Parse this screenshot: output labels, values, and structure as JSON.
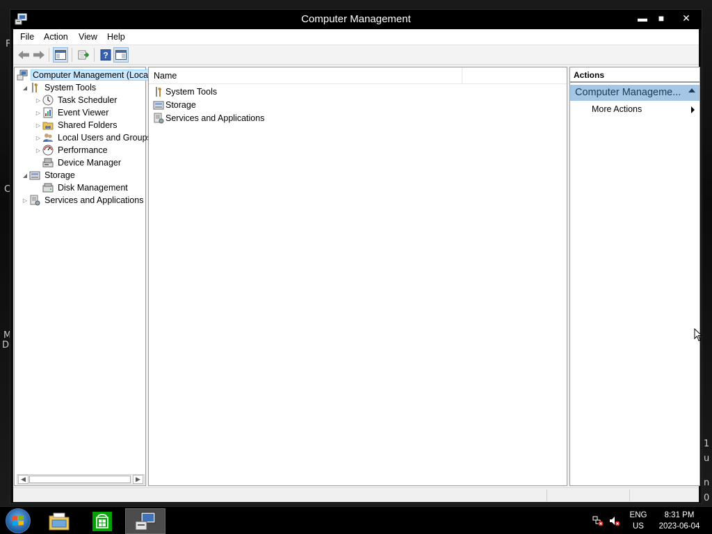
{
  "window": {
    "title": "Computer Management",
    "controls": {
      "minimize": "▬",
      "maximize": "■",
      "close": "✕"
    }
  },
  "menubar": [
    "File",
    "Action",
    "View",
    "Help"
  ],
  "toolbar": {
    "icons": [
      "back-arrow-icon",
      "forward-arrow-icon",
      "show-hide-console-tree-icon",
      "export-list-icon",
      "help-icon",
      "show-hide-action-pane-icon"
    ]
  },
  "tree": {
    "root": "Computer Management (Local",
    "items": [
      {
        "label": "System Tools",
        "icon": "tools-icon",
        "expander": "◢"
      },
      {
        "label": "Task Scheduler",
        "icon": "clock-icon",
        "expander": "▷"
      },
      {
        "label": "Event Viewer",
        "icon": "event-viewer-icon",
        "expander": "▷"
      },
      {
        "label": "Shared Folders",
        "icon": "shared-folder-icon",
        "expander": "▷"
      },
      {
        "label": "Local Users and Groups",
        "icon": "users-icon",
        "expander": "▷"
      },
      {
        "label": "Performance",
        "icon": "performance-icon",
        "expander": "▷"
      },
      {
        "label": "Device Manager",
        "icon": "device-manager-icon",
        "expander": ""
      },
      {
        "label": "Storage",
        "icon": "storage-icon",
        "expander": "◢"
      },
      {
        "label": "Disk Management",
        "icon": "disk-icon",
        "expander": ""
      },
      {
        "label": "Services and Applications",
        "icon": "services-icon",
        "expander": "▷"
      }
    ]
  },
  "center": {
    "column_header": "Name",
    "rows": [
      {
        "label": "System Tools",
        "icon": "tools-icon"
      },
      {
        "label": "Storage",
        "icon": "storage-icon"
      },
      {
        "label": "Services and Applications",
        "icon": "services-icon"
      }
    ]
  },
  "actions": {
    "header": "Actions",
    "group": "Computer Manageme...",
    "item": "More Actions"
  },
  "taskbar": {
    "apps": [
      "file-explorer-icon",
      "store-icon",
      "computer-management-icon"
    ],
    "lang_top": "ENG",
    "lang_bottom": "US",
    "time": "8:31 PM",
    "date": "2023-06-04"
  },
  "desktop_fragments": [
    "F",
    "C",
    "M",
    "D",
    "1",
    "u",
    "n",
    "0"
  ],
  "colors": {
    "selection_bg": "#cce8ff",
    "actions_group_bg": "#a5c6e4",
    "titlebar": "#000000"
  }
}
